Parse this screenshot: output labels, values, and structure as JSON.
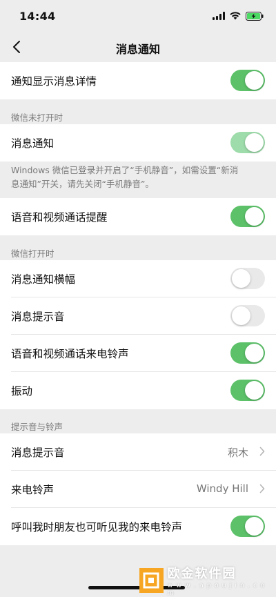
{
  "status": {
    "time": "14:44"
  },
  "nav": {
    "title": "消息通知"
  },
  "rows": {
    "show_detail": {
      "label": "通知显示消息详情"
    },
    "msg_notify": {
      "label": "消息通知"
    },
    "call_remind": {
      "label": "语音和视频通话提醒"
    },
    "banner": {
      "label": "消息通知横幅"
    },
    "msg_sound": {
      "label": "消息提示音"
    },
    "call_ring": {
      "label": "语音和视频通话来电铃声"
    },
    "vibrate": {
      "label": "振动"
    },
    "tone": {
      "label": "消息提示音",
      "value": "积木"
    },
    "ringtone": {
      "label": "来电铃声",
      "value": "Windy Hill"
    },
    "share_ring": {
      "label": "呼叫我时朋友也可听见我的来电铃声"
    }
  },
  "sections": {
    "closed": "微信未打开时",
    "opened": "微信打开时",
    "tones": "提示音与铃声"
  },
  "notes": {
    "windows_line1": "Windows 微信已登录并开启了“手机静音”，如需设置“新消",
    "windows_line2": "息通知”开关，请先关闭“手机静音”。"
  },
  "watermark": {
    "main": "欧金软件园",
    "sub": "w w w . a p o u j i n . c o m"
  },
  "colors": {
    "toggle_on": "#5cc169",
    "toggle_disabled": "#9edcab",
    "toggle_off": "#e9e9ea"
  }
}
